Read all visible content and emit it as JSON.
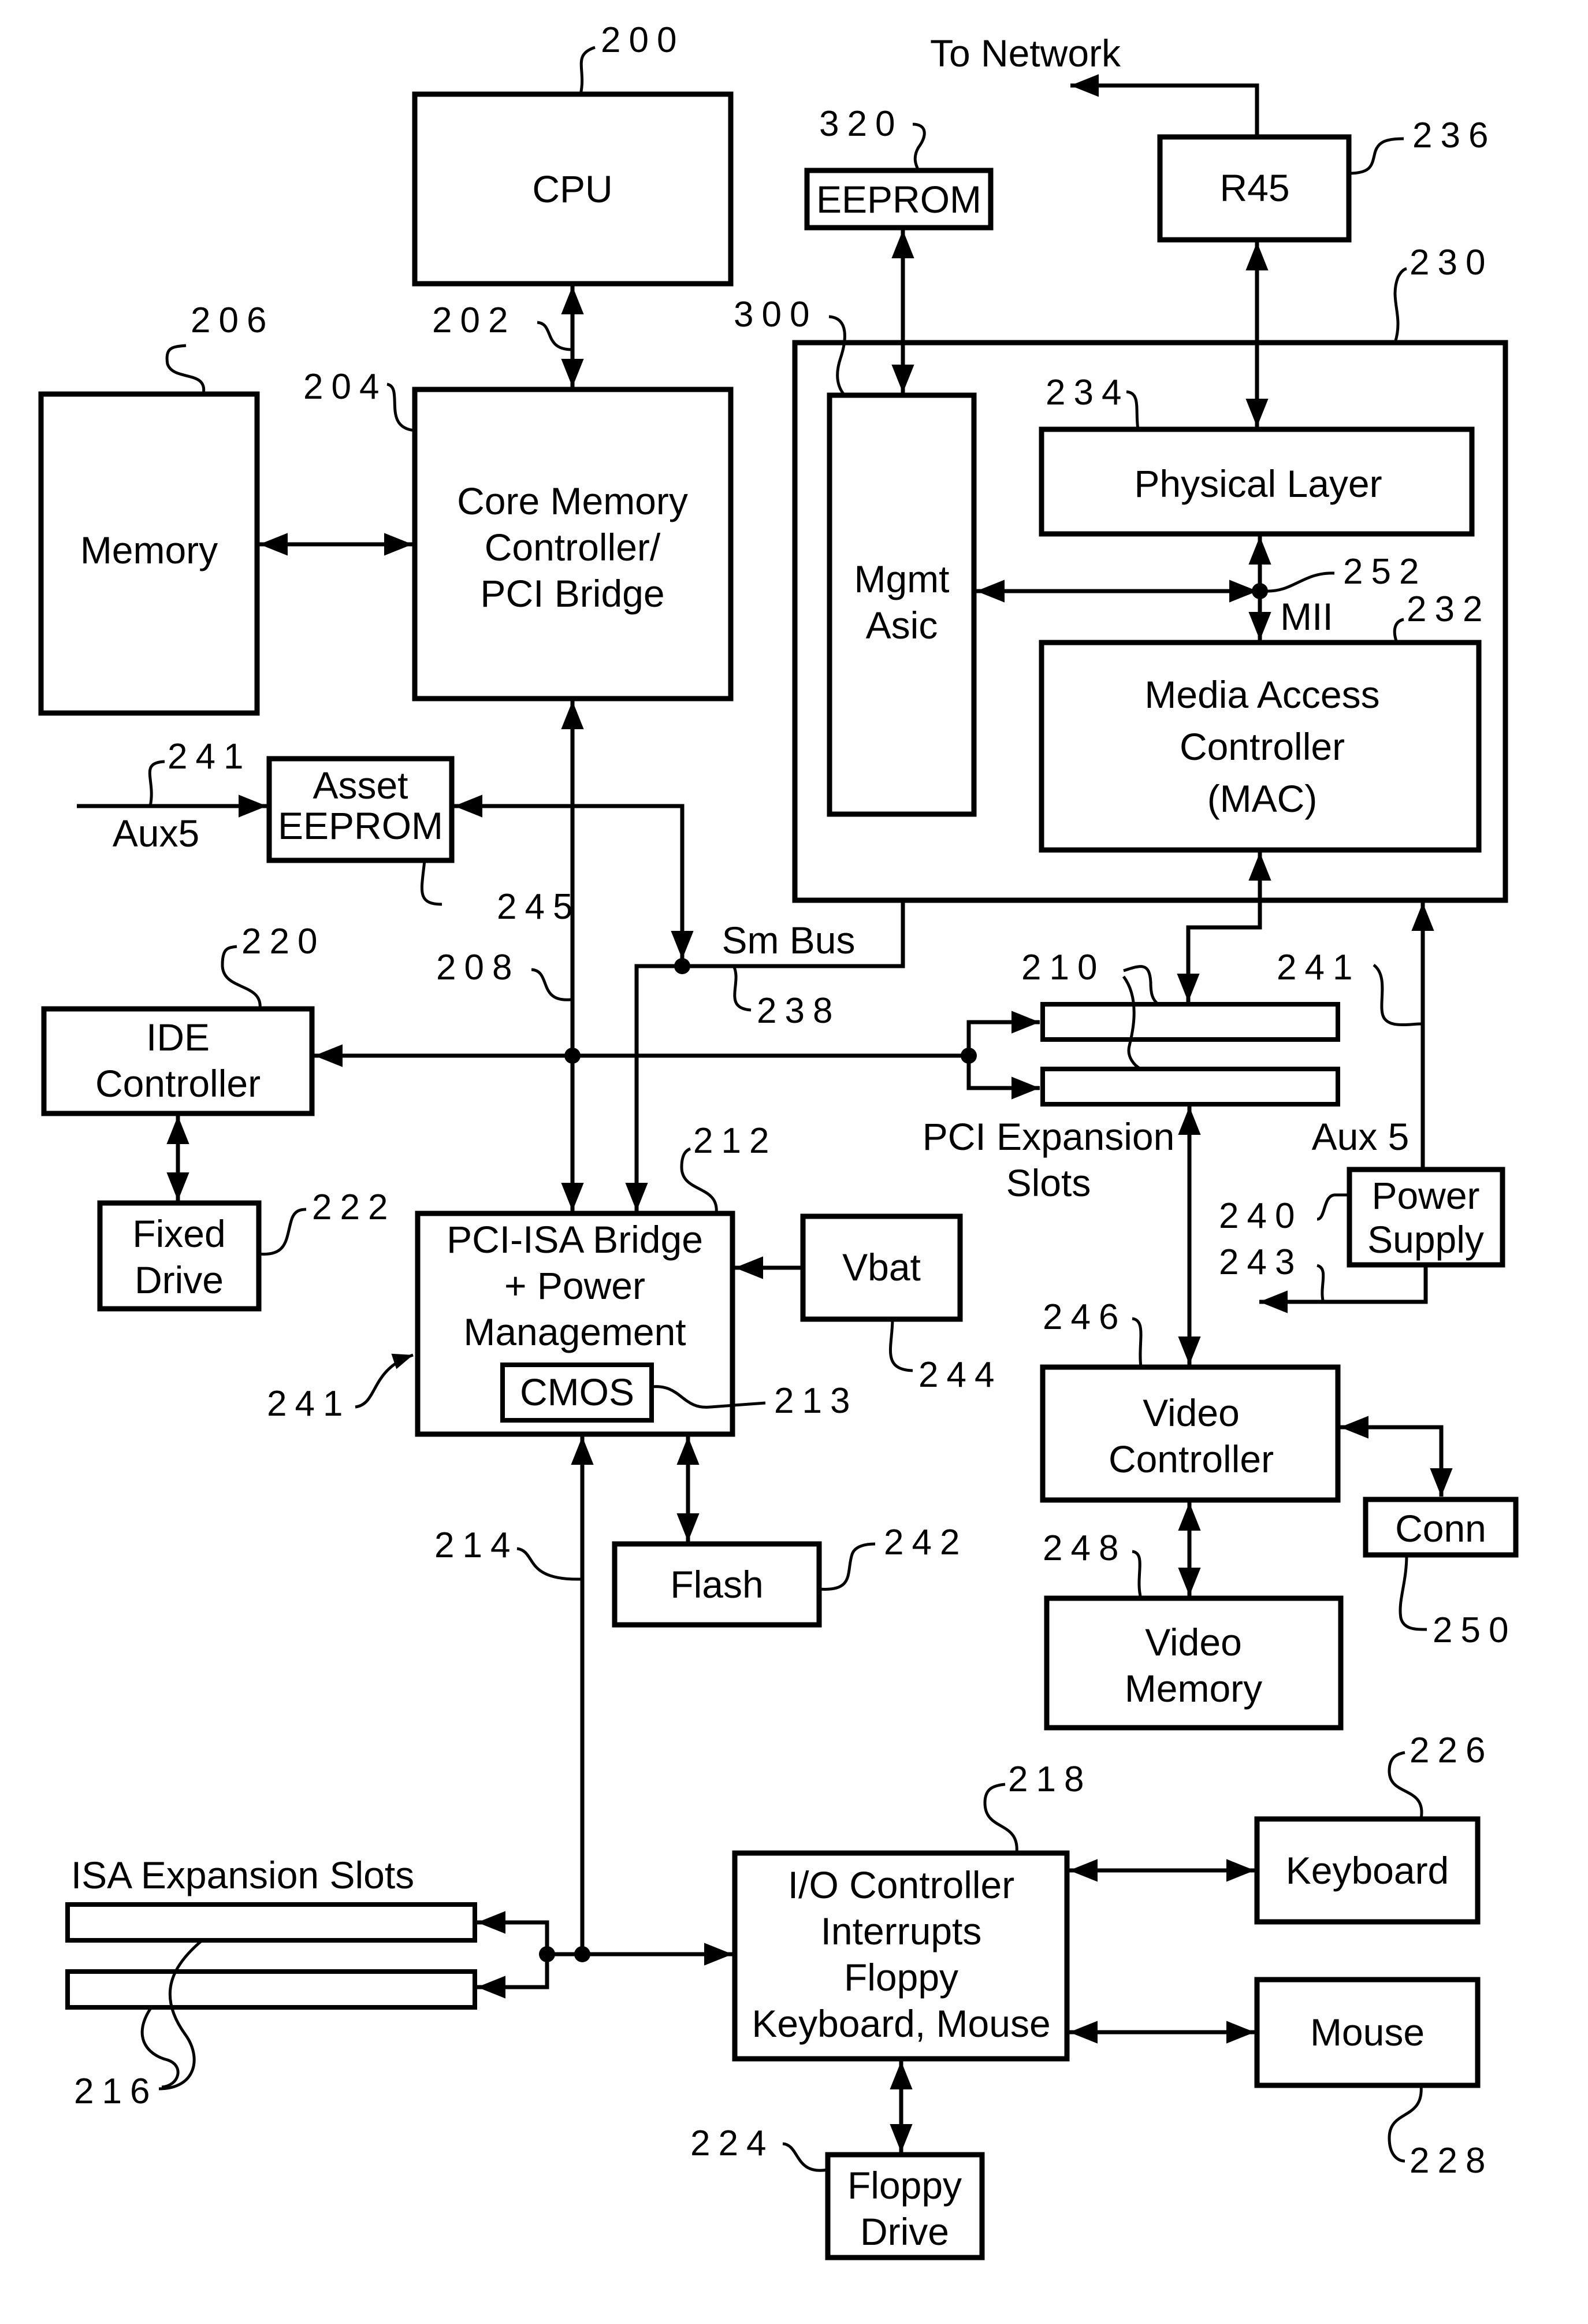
{
  "diagram": {
    "blocks": {
      "cpu": {
        "label": [
          "CPU"
        ],
        "ref": "200"
      },
      "core": {
        "label": [
          "Core Memory",
          "Controller/",
          "PCI Bridge"
        ],
        "ref": "204"
      },
      "memory": {
        "label": [
          "Memory"
        ],
        "ref": "206"
      },
      "asset_eeprom": {
        "label": [
          "Asset",
          "EEPROM"
        ],
        "ref": "245"
      },
      "ide": {
        "label": [
          "IDE",
          "Controller"
        ],
        "ref": "220"
      },
      "fixed_drive": {
        "label": [
          "Fixed",
          "Drive"
        ],
        "ref": "222"
      },
      "pci_isa": {
        "label": [
          "PCI-ISA Bridge",
          "+ Power",
          "Management"
        ],
        "ref": "212"
      },
      "cmos": {
        "label": [
          "CMOS"
        ],
        "ref": "213"
      },
      "vbat": {
        "label": [
          "Vbat"
        ],
        "ref": "244"
      },
      "flash": {
        "label": [
          "Flash"
        ],
        "ref": "242"
      },
      "io": {
        "label": [
          "I/O Controller",
          "Interrupts",
          "Floppy",
          "Keyboard, Mouse"
        ],
        "ref": "218"
      },
      "keyboard": {
        "label": [
          "Keyboard"
        ],
        "ref": "226"
      },
      "mouse": {
        "label": [
          "Mouse"
        ],
        "ref": "228"
      },
      "floppy": {
        "label": [
          "Floppy",
          "Drive"
        ],
        "ref": "224"
      },
      "eeprom": {
        "label": [
          "EEPROM"
        ],
        "ref": "320"
      },
      "r45": {
        "label": [
          "R45"
        ],
        "ref": "236"
      },
      "nic": {
        "ref": "230"
      },
      "mgmt": {
        "label": [
          "Mgmt",
          "Asic"
        ],
        "ref": "300"
      },
      "phy": {
        "label": [
          "Physical Layer"
        ],
        "ref": "234"
      },
      "mac": {
        "label": [
          "Media Access",
          "Controller",
          "(MAC)"
        ],
        "ref": "232"
      },
      "power": {
        "label": [
          "Power",
          "Supply"
        ],
        "ref": "240"
      },
      "video_ctrl": {
        "label": [
          "Video",
          "Controller"
        ],
        "ref": "246"
      },
      "video_mem": {
        "label": [
          "Video",
          "Memory"
        ],
        "ref": "248"
      },
      "conn": {
        "label": [
          "Conn"
        ],
        "ref": "250"
      }
    },
    "texts": {
      "to_network": "To Network",
      "aux5_left": "Aux5",
      "aux5_right": "Aux 5",
      "sm_bus": "Sm Bus",
      "mii": "MII",
      "pci_slots": [
        "PCI Expansion",
        "Slots"
      ],
      "isa_slots": "ISA Expansion Slots"
    },
    "refs": {
      "cpu_bus": "202",
      "pci_bus": "208",
      "aux5_in": "241",
      "smbus": "238",
      "pci_slots": "210",
      "aux5_line": "241",
      "power_out": "243",
      "pm_signal": "241",
      "isa_bus": "214",
      "isa_slots": "216",
      "mii_node": "252"
    }
  }
}
